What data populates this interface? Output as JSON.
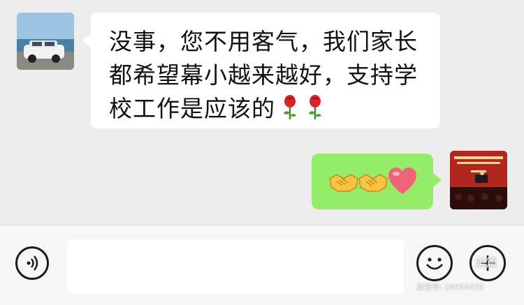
{
  "chat": {
    "incoming": {
      "text": "没事，您不用客气，我们家长都希望幕小越来越好，支持学校工作是应该的",
      "emojis": [
        "rose",
        "rose"
      ]
    },
    "outgoing": {
      "emojis": [
        "handshake",
        "handshake",
        "heart"
      ]
    }
  },
  "input_bar": {
    "voice_icon": "voice-icon",
    "emoji_icon": "emoji-icon",
    "plus_icon": "plus-icon",
    "text_value": ""
  },
  "watermark": {
    "logo": "美篇",
    "id": "美篇号: 26954420"
  },
  "colors": {
    "background": "#ededed",
    "incoming_bubble": "#ffffff",
    "outgoing_bubble": "#95ec69",
    "input_bar": "#f6f6f6"
  }
}
